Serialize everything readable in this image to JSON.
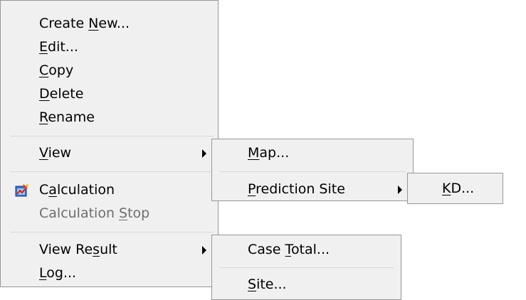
{
  "main_menu": {
    "items": [
      {
        "pre": "Create ",
        "key": "N",
        "post": "ew..."
      },
      {
        "pre": "",
        "key": "E",
        "post": "dit..."
      },
      {
        "pre": "",
        "key": "C",
        "post": "opy"
      },
      {
        "pre": "",
        "key": "D",
        "post": "elete"
      },
      {
        "pre": "",
        "key": "R",
        "post": "ename"
      },
      {
        "pre": "",
        "key": "V",
        "post": "iew"
      },
      {
        "pre": "C",
        "key": "a",
        "post": "lculation",
        "icon": "calculation-icon"
      },
      {
        "pre": "Calculation ",
        "key": "S",
        "post": "top",
        "disabled": true
      },
      {
        "pre": "View Re",
        "key": "s",
        "post": "ult"
      },
      {
        "pre": "",
        "key": "L",
        "post": "og..."
      }
    ]
  },
  "view_submenu": {
    "items": [
      {
        "pre": "",
        "key": "M",
        "post": "ap..."
      },
      {
        "pre": "",
        "key": "P",
        "post": "rediction Site"
      }
    ]
  },
  "prediction_site_submenu": {
    "items": [
      {
        "pre": "",
        "key": "K",
        "post": "D..."
      }
    ]
  },
  "view_result_submenu": {
    "items": [
      {
        "pre": "Case ",
        "key": "T",
        "post": "otal..."
      },
      {
        "pre": "",
        "key": "S",
        "post": "ite..."
      }
    ]
  },
  "icons": {
    "submenu_arrow": "triangle-right-icon",
    "calculation": "calculation-icon"
  },
  "colors": {
    "menu_background": "#f0f0f0",
    "menu_border": "#979797",
    "separator": "#d7d7d7",
    "disabled_text": "#6d6d6d"
  }
}
